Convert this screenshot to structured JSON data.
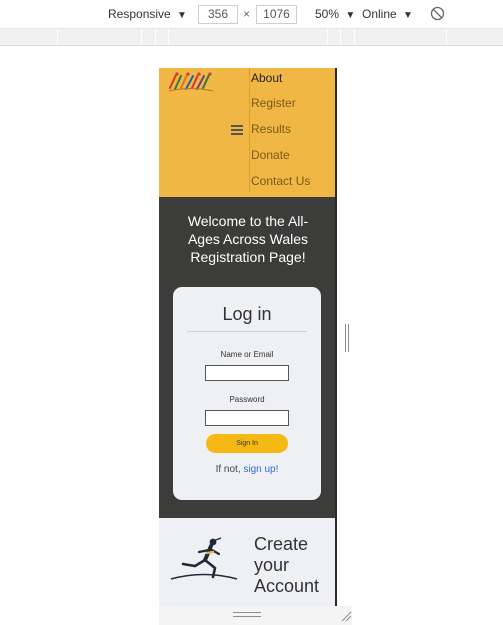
{
  "toolbar": {
    "device": "Responsive",
    "width": "356",
    "height": "1076",
    "times": "×",
    "zoom": "50%",
    "network": "Online",
    "dropdown_glyph": "▼"
  },
  "site": {
    "nav": {
      "items": [
        "About",
        "Register",
        "Results",
        "Donate",
        "Contact Us"
      ],
      "active_index": 0
    },
    "welcome": "Welcome to the All-Ages Across Wales Registration Page!",
    "login": {
      "title": "Log in",
      "name_label": "Name or Email",
      "name_value": "",
      "password_label": "Password",
      "password_value": "",
      "submit": "Sign In",
      "signup_prefix": "If not,",
      "signup_link": "sign up!"
    },
    "create": {
      "text": "Create your Account"
    }
  },
  "colors": {
    "nav_bg": "#f0b744",
    "page_bg": "#3c3c3b",
    "card_bg": "#eff0f4",
    "button": "#f6b914",
    "link": "#2f6fd6"
  },
  "icons": [
    "hamburger-menu-icon",
    "rotate-device-icon",
    "logo-image",
    "runner-illustration"
  ]
}
